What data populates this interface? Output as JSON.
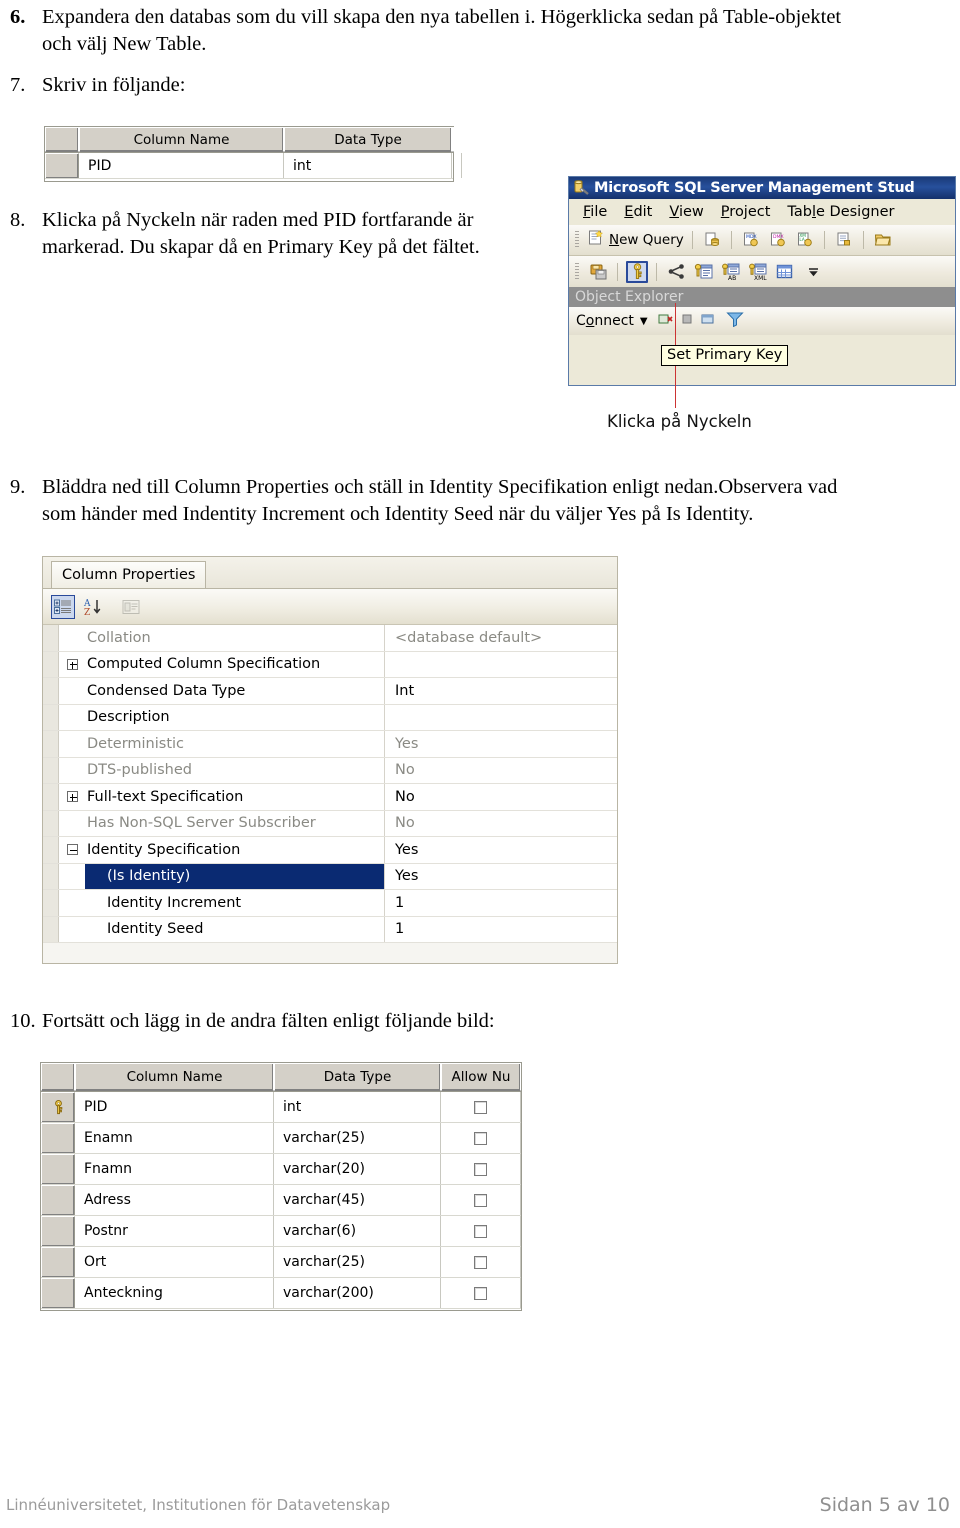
{
  "steps": {
    "s6": {
      "number": "6.",
      "line1": "Expandera den databas som du vill skapa den nya tabellen i. Högerklicka sedan på Table-objektet",
      "line2": "och välj New Table."
    },
    "s7": {
      "number": "7.",
      "line1": "Skriv in följande:"
    },
    "s8": {
      "number": "8.",
      "line1": "Klicka på Nyckeln när raden med PID fortfarande är",
      "line2": "markerad. Du skapar då en Primary Key på det fältet."
    },
    "s9": {
      "number": "9.",
      "line1": "Bläddra ned till Column Properties och ställ in Identity Specifikation enligt nedan.Observera vad",
      "line2": "som händer med Indentity Increment och Identity Seed när du väljer Yes på Is Identity."
    },
    "s10": {
      "number": "10.",
      "line1": "Fortsätt och lägg in de andra fälten enligt följande bild:"
    }
  },
  "table_small": {
    "headers": {
      "gutter": "",
      "column_name": "Column Name",
      "data_type": "Data Type"
    },
    "rows": [
      {
        "column_name": "PID",
        "data_type": "int"
      }
    ]
  },
  "ssms": {
    "title": "Microsoft SQL Server Management Stud",
    "menu": [
      {
        "label": "File",
        "accel": "F"
      },
      {
        "label": "Edit",
        "accel": "E"
      },
      {
        "label": "View",
        "accel": "V"
      },
      {
        "label": "Project",
        "accel": "P"
      },
      {
        "label": "Table Designer",
        "accel": "l"
      }
    ],
    "toolbar1": {
      "new_query_label": "New Query",
      "icons": [
        "new-query-icon",
        "new-database-query-icon",
        "new-mdx-query-icon",
        "new-dmx-query-icon",
        "new-xmla-query-icon",
        "new-analysis-query-icon",
        "open-file-icon"
      ]
    },
    "toolbar2": {
      "icons": [
        "save-icon",
        "set-primary-key-icon",
        "relationships-icon",
        "manage-indexes-icon",
        "manage-check-constraints-icon",
        "manage-xml-indexes-icon",
        "manage-fulltext-index-icon",
        "toolbar-overflow-icon"
      ],
      "selected_icon": "set-primary-key-icon"
    },
    "object_explorer_label": "Object Explorer",
    "connect_label": "Connect",
    "tooltip": "Set Primary Key",
    "callout": "Klicka på Nyckeln",
    "colors": {
      "titlebar": "#1a3a78",
      "selection": "#0a2a72",
      "tooltip_bg": "#ffffe1",
      "callout_line": "#cc3333"
    }
  },
  "column_properties": {
    "tab_label": "Column Properties",
    "toolbar_icons": [
      "categorized-view-icon",
      "alphabetical-sort-icon",
      "property-pages-icon"
    ],
    "selected_toolbar_icon": "categorized-view-icon",
    "rows": [
      {
        "expander": "",
        "name": "Collation",
        "value": "<database default>",
        "name_style": "dim",
        "value_style": "dim",
        "indent": 0,
        "selected": false
      },
      {
        "expander": "plus",
        "name": "Computed Column Specification",
        "value": "",
        "name_style": "dark",
        "value_style": "dark",
        "indent": 0,
        "selected": false
      },
      {
        "expander": "",
        "name": "Condensed Data Type",
        "value": "Int",
        "name_style": "dark",
        "value_style": "dark",
        "indent": 0,
        "selected": false
      },
      {
        "expander": "",
        "name": "Description",
        "value": "",
        "name_style": "dark",
        "value_style": "dark",
        "indent": 0,
        "selected": false
      },
      {
        "expander": "",
        "name": "Deterministic",
        "value": "Yes",
        "name_style": "dim",
        "value_style": "dim",
        "indent": 0,
        "selected": false
      },
      {
        "expander": "",
        "name": "DTS-published",
        "value": "No",
        "name_style": "dim",
        "value_style": "dim",
        "indent": 0,
        "selected": false
      },
      {
        "expander": "plus",
        "name": "Full-text Specification",
        "value": "No",
        "name_style": "dark",
        "value_style": "dark",
        "indent": 0,
        "selected": false
      },
      {
        "expander": "",
        "name": "Has Non-SQL Server Subscriber",
        "value": "No",
        "name_style": "dim",
        "value_style": "dim",
        "indent": 0,
        "selected": false
      },
      {
        "expander": "minus",
        "name": "Identity Specification",
        "value": "Yes",
        "name_style": "dark",
        "value_style": "dark",
        "indent": 0,
        "selected": false
      },
      {
        "expander": "",
        "name": "(Is Identity)",
        "value": "Yes",
        "name_style": "dark",
        "value_style": "dark",
        "indent": 1,
        "selected": true
      },
      {
        "expander": "",
        "name": "Identity Increment",
        "value": "1",
        "name_style": "dark",
        "value_style": "dark",
        "indent": 1,
        "selected": false
      },
      {
        "expander": "",
        "name": "Identity Seed",
        "value": "1",
        "name_style": "dark",
        "value_style": "dark",
        "indent": 1,
        "selected": false
      }
    ]
  },
  "table_full": {
    "headers": {
      "gutter": "",
      "column_name": "Column Name",
      "data_type": "Data Type",
      "allow_nulls": "Allow Nu"
    },
    "rows": [
      {
        "key": true,
        "column_name": "PID",
        "data_type": "int",
        "allow_nulls": false
      },
      {
        "key": false,
        "column_name": "Enamn",
        "data_type": "varchar(25)",
        "allow_nulls": false
      },
      {
        "key": false,
        "column_name": "Fnamn",
        "data_type": "varchar(20)",
        "allow_nulls": false
      },
      {
        "key": false,
        "column_name": "Adress",
        "data_type": "varchar(45)",
        "allow_nulls": false
      },
      {
        "key": false,
        "column_name": "Postnr",
        "data_type": "varchar(6)",
        "allow_nulls": false
      },
      {
        "key": false,
        "column_name": "Ort",
        "data_type": "varchar(25)",
        "allow_nulls": false
      },
      {
        "key": false,
        "column_name": "Anteckning",
        "data_type": "varchar(200)",
        "allow_nulls": false
      }
    ]
  },
  "footer": {
    "left": "Linnéuniversitetet, Institutionen för Datavetenskap",
    "right": "Sidan 5 av 10"
  }
}
